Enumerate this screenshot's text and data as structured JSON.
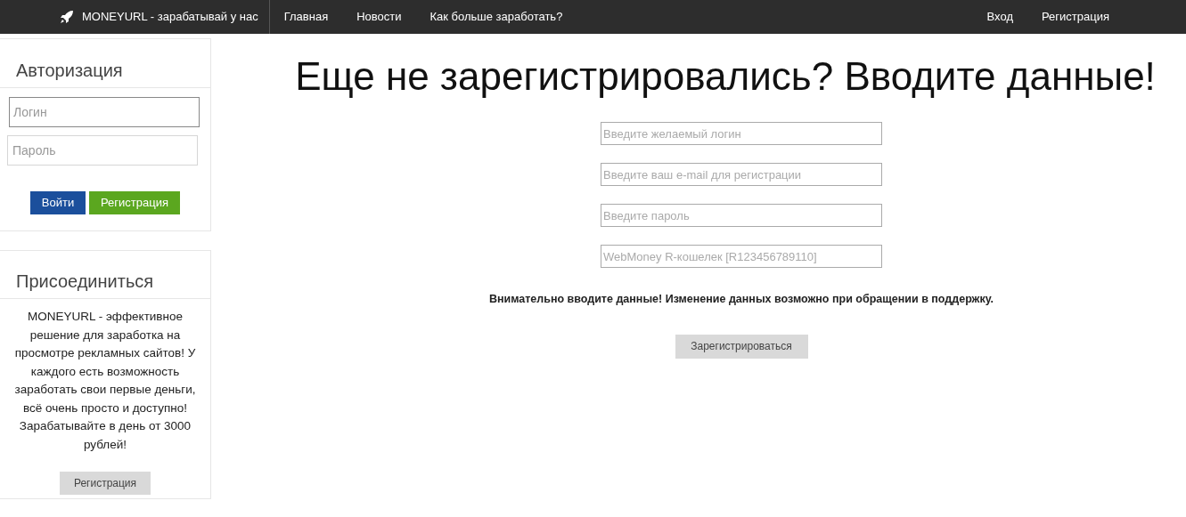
{
  "navbar": {
    "brand": "MONEYURL - зарабатывай у нас",
    "links": [
      {
        "label": "Главная"
      },
      {
        "label": "Новости"
      },
      {
        "label": "Как больше заработать?"
      }
    ],
    "right_links": [
      {
        "label": "Вход"
      },
      {
        "label": "Регистрация"
      }
    ]
  },
  "login_panel": {
    "title": "Авторизация",
    "fields": [
      {
        "placeholder": "Логин",
        "focused": true
      },
      {
        "placeholder": "Пароль",
        "focused": false
      }
    ],
    "buttons": [
      {
        "label": "Войти",
        "kind": "primary"
      },
      {
        "label": "Регистрация",
        "kind": "success"
      }
    ]
  },
  "join_panel": {
    "title": "Присоединиться",
    "text": "MONEYURL - эффективное решение для заработка на просмотре рекламных сайтов! У каждого есть возможность заработать свои первые деньги, всё очень просто и доступно! Зарабатывайте в день от 3000 рублей!",
    "button": "Регистрация"
  },
  "register_form": {
    "heading": "Еще не зарегистрировались? Вводите данные!",
    "fields": [
      {
        "placeholder": "Введите желаемый логин"
      },
      {
        "placeholder": "Введите ваш e-mail для регистрации"
      },
      {
        "placeholder": "Введите пароль"
      },
      {
        "placeholder": "WebMoney R-кошелек [R123456789110]"
      }
    ],
    "notice": "Внимательно вводите данные! Изменение данных возможно при обращении в поддержку.",
    "submit": "Зарегистрироваться"
  }
}
